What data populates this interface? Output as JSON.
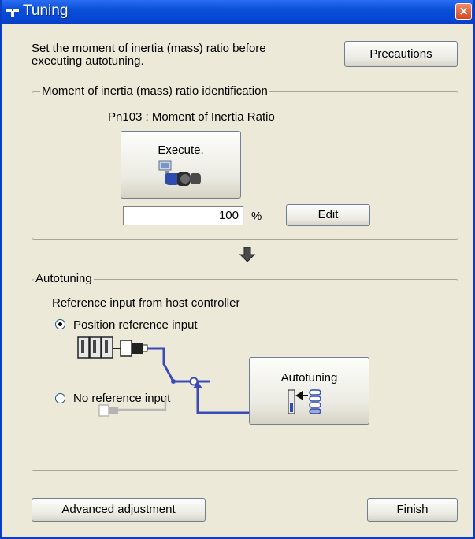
{
  "window": {
    "title": "Tuning",
    "close_glyph": "×"
  },
  "intro": {
    "text_line1": "Set the moment of inertia (mass) ratio before",
    "text_line2": "executing autotuning."
  },
  "buttons": {
    "precautions": "Precautions",
    "execute": "Execute.",
    "edit": "Edit",
    "autotuning": "Autotuning",
    "advanced": "Advanced adjustment",
    "finish": "Finish"
  },
  "inertia_group": {
    "legend": "Moment of inertia (mass) ratio identification",
    "param_label": "Pn103 : Moment of Inertia Ratio",
    "value": "100",
    "unit": "%"
  },
  "autotuning_group": {
    "legend": "Autotuning",
    "ref_label": "Reference input from host controller",
    "option_position": "Position reference input",
    "option_none": "No reference input",
    "selected": "Position reference input"
  },
  "icons": {
    "title": "tuning-app-icon",
    "execute": "motor-identify-icon",
    "autotuning": "autotuning-icon",
    "arrow": "down-arrow-icon",
    "controller": "host-controller-icon",
    "connector_active": "connector-icon",
    "connector_inactive": "connector-disabled-icon"
  },
  "colors": {
    "titlebar": "#0a4fd8",
    "dialog": "#ece9d8",
    "signal_line": "#3a4ab8",
    "inactive_line": "#b8b8b8"
  }
}
